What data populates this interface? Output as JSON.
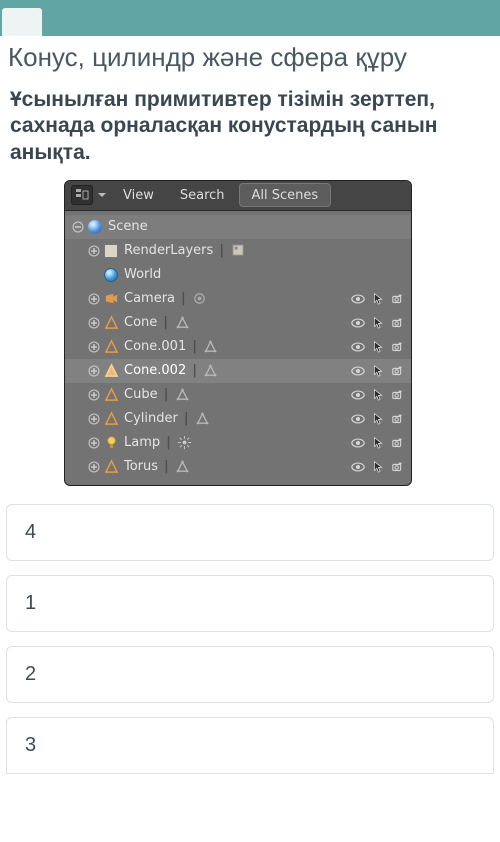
{
  "title": "Конус, цилиндр және сфера құру",
  "question": "Ұсынылған примитивтер тізімін зерттеп, сахнада орналасқан конустардың санын анықта.",
  "outliner": {
    "header": {
      "view": "View",
      "search": "Search",
      "scenes": "All Scenes"
    },
    "root": "Scene",
    "items": [
      {
        "name": "RenderLayers",
        "icon": "render-doc",
        "sub": "layers",
        "vis": false
      },
      {
        "name": "World",
        "icon": "world",
        "sub": null,
        "vis": false,
        "noexpand": true
      },
      {
        "name": "Camera",
        "icon": "camera",
        "sub": "camdata",
        "vis": true
      },
      {
        "name": "Cone",
        "icon": "mesh",
        "sub": "mesh",
        "vis": true
      },
      {
        "name": "Cone.001",
        "icon": "mesh",
        "sub": "mesh",
        "vis": true
      },
      {
        "name": "Cone.002",
        "icon": "mesh-sel",
        "sub": "mesh",
        "vis": true,
        "selected": true
      },
      {
        "name": "Cube",
        "icon": "mesh",
        "sub": "mesh",
        "vis": true
      },
      {
        "name": "Cylinder",
        "icon": "mesh",
        "sub": "mesh",
        "vis": true
      },
      {
        "name": "Lamp",
        "icon": "lamp",
        "sub": "lampdata",
        "vis": true
      },
      {
        "name": "Torus",
        "icon": "mesh",
        "sub": "mesh",
        "vis": true
      }
    ]
  },
  "answers": [
    "4",
    "1",
    "2",
    "3"
  ]
}
